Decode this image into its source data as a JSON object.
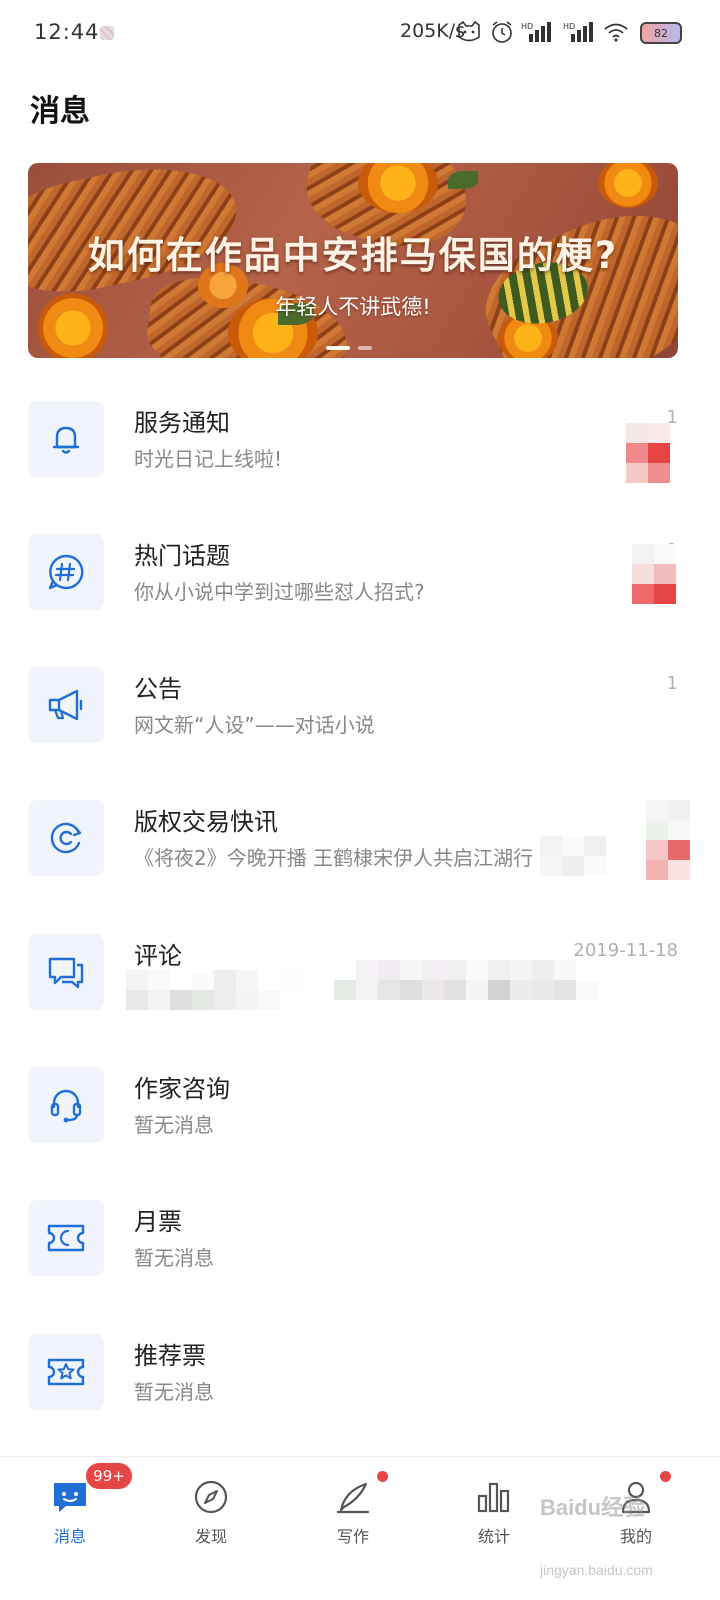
{
  "status_bar": {
    "time": "12:44",
    "network_speed": "205K/s",
    "battery": "82"
  },
  "page": {
    "title": "消息"
  },
  "banner": {
    "title": "如何在作品中安排马保国的梗?",
    "subtitle": "年轻人不讲武德!",
    "page_count": 2,
    "active_index": 0
  },
  "messages": [
    {
      "icon": "bell-icon",
      "title": "服务通知",
      "subtitle": "时光日记上线啦!",
      "time": "1"
    },
    {
      "icon": "hashtag-icon",
      "title": "热门话题",
      "subtitle": "你从小说中学到过哪些怼人招式?",
      "time": "1"
    },
    {
      "icon": "megaphone-icon",
      "title": "公告",
      "subtitle": "网文新“人设”——对话小说",
      "time": "1"
    },
    {
      "icon": "copyright-refresh-icon",
      "title": "版权交易快讯",
      "subtitle": "《将夜2》今晚开播 王鹤棣宋伊人共启江湖行",
      "time": "01"
    },
    {
      "icon": "comment-icon",
      "title": "评论",
      "subtitle": "",
      "time": "2019-11-18"
    },
    {
      "icon": "headset-icon",
      "title": "作家咨询",
      "subtitle": "暂无消息",
      "time": ""
    },
    {
      "icon": "moon-ticket-icon",
      "title": "月票",
      "subtitle": "暂无消息",
      "time": ""
    },
    {
      "icon": "star-ticket-icon",
      "title": "推荐票",
      "subtitle": "暂无消息",
      "time": ""
    }
  ],
  "tabs": [
    {
      "icon": "message-icon",
      "label": "消息",
      "active": true,
      "badge": "99+"
    },
    {
      "icon": "compass-icon",
      "label": "发现",
      "active": false
    },
    {
      "icon": "pen-icon",
      "label": "写作",
      "active": false,
      "dot": true
    },
    {
      "icon": "bar-chart-icon",
      "label": "统计",
      "active": false
    },
    {
      "icon": "user-icon",
      "label": "我的",
      "active": false,
      "dot": true
    }
  ],
  "watermark": {
    "text": "Baidu经验",
    "sub": "jingyan.baidu.com"
  },
  "colors": {
    "accent": "#1f6fd6",
    "badge_red": "#e64545",
    "icon_bg": "#f1f5fb",
    "subtitle_gray": "#888888"
  }
}
